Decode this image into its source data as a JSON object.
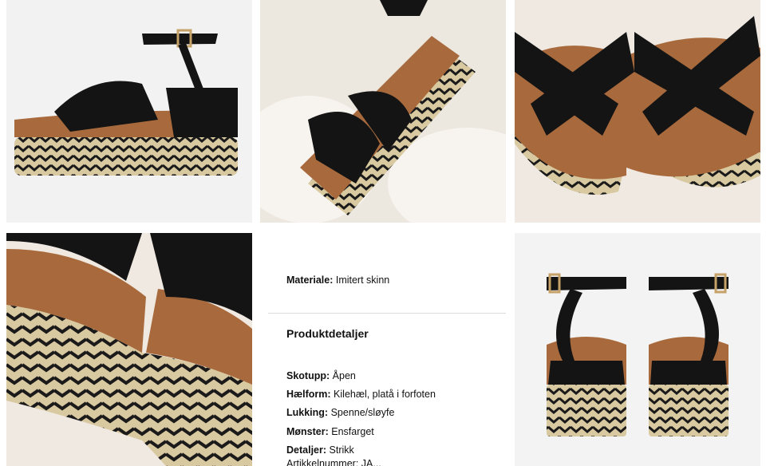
{
  "images": [
    {
      "name": "side-view",
      "alt": ""
    },
    {
      "name": "worn-fur-view",
      "alt": ""
    },
    {
      "name": "straps-closeup",
      "alt": ""
    },
    {
      "name": "sole-closeup",
      "alt": ""
    },
    {
      "name": "back-view",
      "alt": ""
    }
  ],
  "colors": {
    "leather": "#141414",
    "footbed": "#a86a3c",
    "jute": "#d9c9a0",
    "jute_dark": "#1a1a1a",
    "buckle": "#c7a268"
  },
  "product": {
    "material_label": "Materiale:",
    "material_value": "Imitert skinn",
    "details_heading": "Produktdetaljer",
    "details": [
      {
        "label": "Skotupp:",
        "value": "Åpen"
      },
      {
        "label": "Hælform:",
        "value": "Kilehæl, platå i forfoten"
      },
      {
        "label": "Lukking:",
        "value": "Spenne/sløyfe"
      },
      {
        "label": "Mønster:",
        "value": "Ensfarget"
      },
      {
        "label": "Detaljer:",
        "value": "Strikk"
      }
    ],
    "cut_off_line": "Artikkelnummer: JA..."
  }
}
